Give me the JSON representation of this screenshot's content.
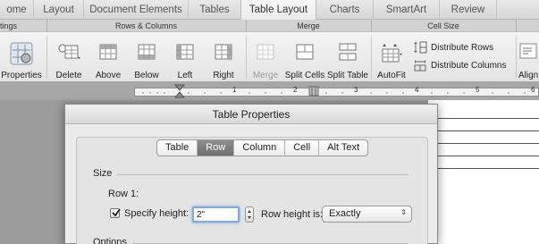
{
  "ribbon_tabs": [
    "ome",
    "Layout",
    "Document Elements",
    "Tables",
    "Table Layout",
    "Charts",
    "SmartArt",
    "Review"
  ],
  "active_tab": "Table Layout",
  "groups": {
    "settings": "tings",
    "rows_columns": "Rows & Columns",
    "merge": "Merge",
    "cell_size": "Cell Size"
  },
  "buttons": {
    "properties": "Properties",
    "delete": "Delete",
    "above": "Above",
    "below": "Below",
    "left": "Left",
    "right": "Right",
    "merge": "Merge",
    "split_cells": "Split Cells",
    "split_table": "Split Table",
    "autofit": "AutoFit",
    "distribute_rows": "Distribute Rows",
    "distribute_columns": "Distribute Columns",
    "align": "Align"
  },
  "ruler": {
    "numbers": [
      "1",
      "2",
      "3",
      "4",
      "5",
      "6"
    ]
  },
  "dialog": {
    "title": "Table Properties",
    "tabs": [
      "Table",
      "Row",
      "Column",
      "Cell",
      "Alt Text"
    ],
    "selected_tab": "Row",
    "size_label": "Size",
    "row_label": "Row 1:",
    "specify_height_label": "Specify height:",
    "specify_height_checked": true,
    "height_value": "2\"",
    "row_height_is_label": "Row height is:",
    "row_height_option": "Exactly",
    "options_label": "Options"
  },
  "colors": {
    "selected_tab": "#7a7a7a",
    "focus_ring": "#7fa9e0"
  }
}
